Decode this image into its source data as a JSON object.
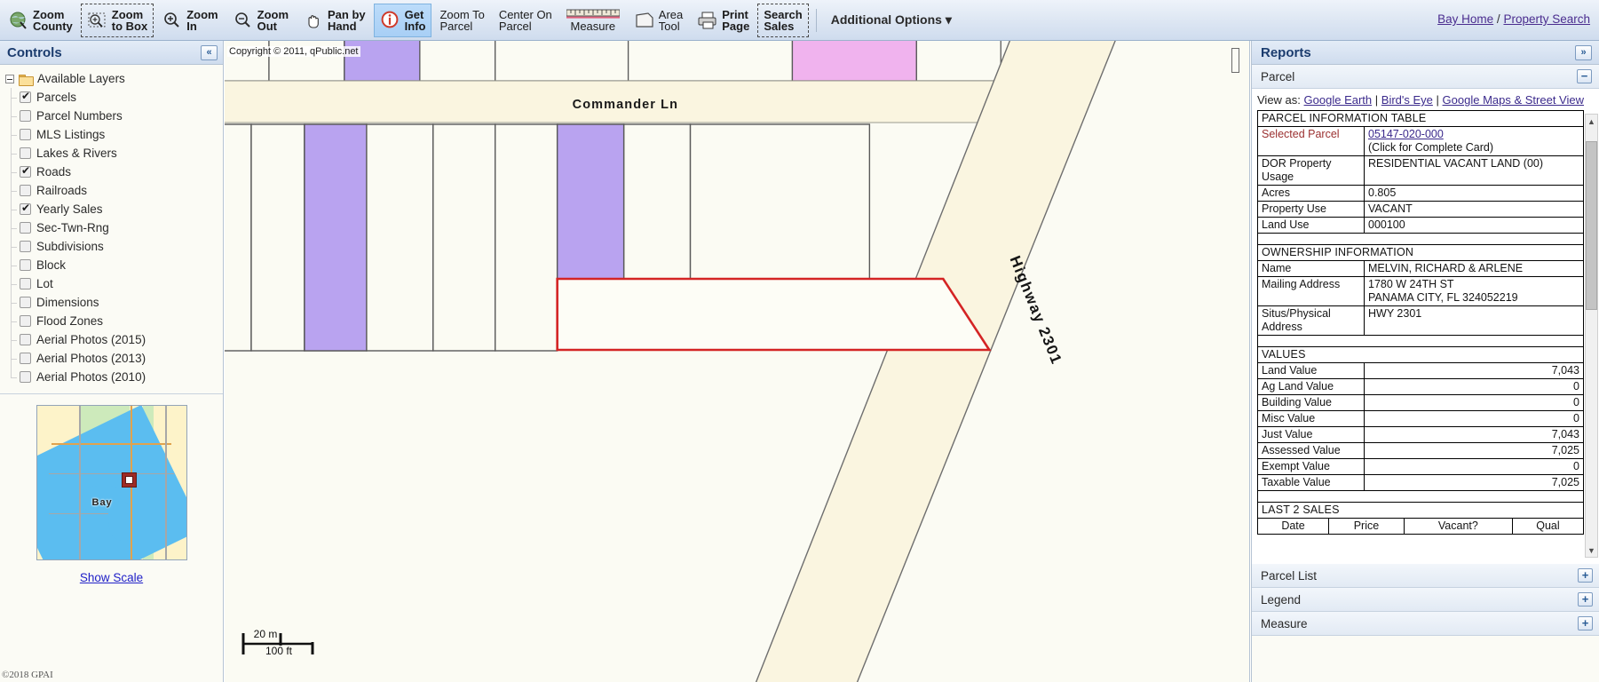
{
  "toolbar": {
    "buttons": [
      {
        "id": "zoom-county",
        "icon": "globe-icon",
        "line1": "Zoom",
        "line2": "County",
        "style": "plain",
        "bold": true
      },
      {
        "id": "zoom-to-box",
        "icon": "zoom-box-icon",
        "line1": "Zoom",
        "line2": "to Box",
        "style": "dashed",
        "bold": true
      },
      {
        "id": "zoom-in",
        "icon": "magnifier-plus-icon",
        "line1": "Zoom",
        "line2": "In",
        "style": "plain",
        "bold": true
      },
      {
        "id": "zoom-out",
        "icon": "magnifier-minus-icon",
        "line1": "Zoom",
        "line2": "Out",
        "style": "plain",
        "bold": true
      },
      {
        "id": "pan-by-hand",
        "icon": "hand-icon",
        "line1": "Pan by",
        "line2": "Hand",
        "style": "plain",
        "bold": true
      },
      {
        "id": "get-info",
        "icon": "info-icon",
        "line1": "Get",
        "line2": "Info",
        "style": "active",
        "bold": true
      },
      {
        "id": "zoom-to-parcel",
        "icon": "none",
        "line1": "Zoom To",
        "line2": "Parcel",
        "style": "plain",
        "bold": false
      },
      {
        "id": "center-on-parcel",
        "icon": "none",
        "line1": "Center On",
        "line2": "Parcel",
        "style": "plain",
        "bold": false
      },
      {
        "id": "measure",
        "icon": "ruler-icon",
        "line1": "",
        "line2": "Measure",
        "style": "plain",
        "bold": false
      },
      {
        "id": "area-tool",
        "icon": "polygon-icon",
        "line1": "Area",
        "line2": "Tool",
        "style": "plain",
        "bold": false
      },
      {
        "id": "print-page",
        "icon": "printer-icon",
        "line1": "Print",
        "line2": "Page",
        "style": "plain",
        "bold": true
      },
      {
        "id": "search-sales",
        "icon": "none",
        "line1": "Search",
        "line2": "Sales",
        "style": "dashed",
        "bold": true
      }
    ],
    "additional_options": "Additional Options",
    "additional_options_caret": "▾"
  },
  "topright": {
    "home_link": "Bay Home",
    "divider": "/",
    "search_link": "Property Search"
  },
  "controls": {
    "title": "Controls",
    "collapse_icon": "«",
    "root_label": "Available Layers",
    "layers": [
      {
        "label": "Parcels",
        "checked": true
      },
      {
        "label": "Parcel Numbers",
        "checked": false
      },
      {
        "label": "MLS Listings",
        "checked": false
      },
      {
        "label": "Lakes & Rivers",
        "checked": false
      },
      {
        "label": "Roads",
        "checked": true
      },
      {
        "label": "Railroads",
        "checked": false
      },
      {
        "label": "Yearly Sales",
        "checked": true
      },
      {
        "label": "Sec-Twn-Rng",
        "checked": false
      },
      {
        "label": "Subdivisions",
        "checked": false
      },
      {
        "label": "Block",
        "checked": false
      },
      {
        "label": "Lot",
        "checked": false
      },
      {
        "label": "Dimensions",
        "checked": false
      },
      {
        "label": "Flood Zones",
        "checked": false
      },
      {
        "label": "Aerial Photos (2015)",
        "checked": false
      },
      {
        "label": "Aerial Photos (2013)",
        "checked": false
      },
      {
        "label": "Aerial Photos (2010)",
        "checked": false
      }
    ],
    "minimap_label": "Bay",
    "show_scale": "Show Scale",
    "copyright": "©2018 GPAI"
  },
  "map": {
    "copyright": "Copyright © 2011, qPublic.net",
    "street_label": "Commander Ln",
    "highway_label": "Highway 2301",
    "scale_metric": "20 m",
    "scale_imperial": "100 ft",
    "colors": {
      "selected_parcel_outline": "#d42424",
      "sale_parcel_fill": "#b9a3f0",
      "sale_parcel_fill_pink": "#f0b3ee",
      "parcel_fill": "#fbfbf3",
      "parcel_stroke": "#595959",
      "road_fill": "#faf5e0"
    }
  },
  "reports": {
    "title": "Reports",
    "expand_icon": "»",
    "sections": [
      {
        "label": "Parcel",
        "state": "−"
      },
      {
        "label": "Parcel List",
        "state": "+"
      },
      {
        "label": "Legend",
        "state": "+"
      },
      {
        "label": "Measure",
        "state": "+"
      }
    ],
    "view_as_prefix": "View as:",
    "view_as_links": [
      "Google Earth",
      "Bird's Eye",
      "Google Maps & Street View"
    ],
    "view_as_sep": "|",
    "parcel_table": {
      "heading": "PARCEL INFORMATION TABLE",
      "rows": [
        {
          "label": "Selected Parcel",
          "label_style": "red",
          "value_link": "05147-020-000",
          "value_sub": "(Click for Complete Card)"
        },
        {
          "label": "DOR Property Usage",
          "value": "RESIDENTIAL VACANT LAND (00)"
        },
        {
          "label": "Acres",
          "value": "0.805"
        },
        {
          "label": "Property Use",
          "value": "VACANT"
        },
        {
          "label": "Land Use",
          "value": "000100"
        }
      ]
    },
    "ownership": {
      "heading": "OWNERSHIP INFORMATION",
      "rows": [
        {
          "label": "Name",
          "value": "MELVIN, RICHARD & ARLENE"
        },
        {
          "label": "Mailing Address",
          "value": "1780 W 24TH ST\nPANAMA CITY, FL 324052219"
        },
        {
          "label": "Situs/Physical Address",
          "value": "HWY 2301"
        }
      ]
    },
    "values": {
      "heading": "VALUES",
      "rows": [
        {
          "label": "Land Value",
          "value": "7,043"
        },
        {
          "label": "Ag Land Value",
          "value": "0"
        },
        {
          "label": "Building Value",
          "value": "0"
        },
        {
          "label": "Misc Value",
          "value": "0"
        },
        {
          "label": "Just Value",
          "value": "7,043"
        },
        {
          "label": "Assessed Value",
          "value": "7,025"
        },
        {
          "label": "Exempt Value",
          "value": "0"
        },
        {
          "label": "Taxable Value",
          "value": "7,025"
        }
      ]
    },
    "sales": {
      "heading": "LAST 2 SALES",
      "columns": [
        "Date",
        "Price",
        "Vacant?",
        "Qual"
      ]
    },
    "scroll_up": "▲",
    "scroll_down": "▼"
  }
}
